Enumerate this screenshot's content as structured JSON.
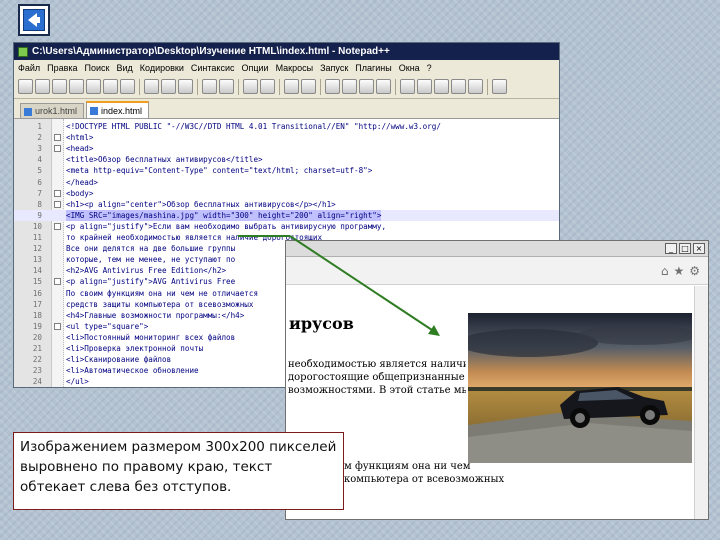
{
  "notepad": {
    "title": "C:\\Users\\Администратор\\Desktop\\Изучение HTML\\index.html - Notepad++",
    "menu": [
      "Файл",
      "Правка",
      "Поиск",
      "Вид",
      "Кодировки",
      "Синтаксис",
      "Опции",
      "Макросы",
      "Запуск",
      "Плагины",
      "Окна",
      "?"
    ],
    "tabs": [
      "urok1.html",
      "index.html"
    ],
    "active_tab_index": 1,
    "code_lines": [
      {
        "n": "1",
        "text": "<!DOCTYPE HTML PUBLIC \"-//W3C//DTD HTML 4.01 Transitional//EN\" \"http://www.w3.org/"
      },
      {
        "n": "2",
        "text": "<html>"
      },
      {
        "n": "3",
        "text": "<head>"
      },
      {
        "n": "4",
        "text": "<title>Обзор бесплатных антивирусов</title>"
      },
      {
        "n": "5",
        "text": "<meta http-equiv=\"Content-Type\" content=\"text/html; charset=utf-8\">"
      },
      {
        "n": "6",
        "text": "</head>"
      },
      {
        "n": "7",
        "text": "<body>"
      },
      {
        "n": "8",
        "text": "<h1><p align=\"center\">Обзор бесплатных антивирусов</p></h1>"
      },
      {
        "n": "9",
        "text": "<IMG SRC=\"images/mashina.jpg\" width=\"300\" height=\"200\" align=\"right\">"
      },
      {
        "n": "10",
        "text": "<p align=\"justify\">Если вам необходимо выбрать антивирусную программу,"
      },
      {
        "n": "11",
        "text": "то крайней необходимостью является наличие дорогостоящих"
      },
      {
        "n": "12",
        "text": "Все они делятся на две большие группы"
      },
      {
        "n": "13",
        "text": "которые, тем не менее, не уступают по"
      },
      {
        "n": "14",
        "text": "<h2>AVG Antivirus Free Edition</h2>"
      },
      {
        "n": "15",
        "text": "<p align=\"justify\">AVG Antivirus Free"
      },
      {
        "n": "16",
        "text": "По своим функциям она ни чем не отличается"
      },
      {
        "n": "17",
        "text": "средств защиты компьютера от всевозможных"
      },
      {
        "n": "18",
        "text": "<h4>Главные возможности программы:</h4>"
      },
      {
        "n": "19",
        "text": "<ul type=\"square\">"
      },
      {
        "n": "20",
        "text": "<li>Постоянный мониторинг всех файлов"
      },
      {
        "n": "21",
        "text": "<li>Проверка электронной почты"
      },
      {
        "n": "22",
        "text": "<li>Сканирование файлов"
      },
      {
        "n": "23",
        "text": "<li>Автоматическое обновление"
      },
      {
        "n": "24",
        "text": "</ul>"
      }
    ],
    "highlighted_line": "9"
  },
  "browser": {
    "window_buttons": [
      "_",
      "□",
      "×"
    ],
    "heading": "ирусов",
    "paragraph_lines": [
      "необходимостью является наличие",
      "дорогостоящие общепризнанные",
      "возможностями. В этой статье мы"
    ],
    "paragraph2_lines": [
      "м функциям она ни чем",
      "компьютера от всевозможных"
    ]
  },
  "caption": {
    "text": "Изображением размером 300х200 пикселей выровнено по правому краю, текст обтекает слева без отступов."
  },
  "colors": {
    "arrow": "#2e7d22",
    "caption_border": "#7a1a1a",
    "title_bar": "#15214d"
  }
}
